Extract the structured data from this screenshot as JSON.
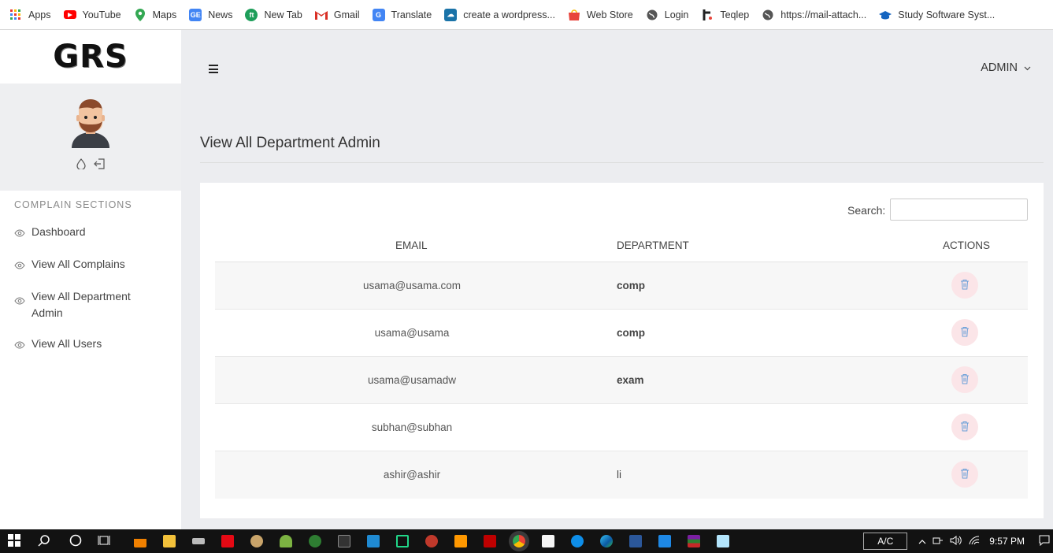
{
  "bookmarks": [
    {
      "label": "Apps",
      "icon": "apps-grid-icon",
      "color": "#e53935"
    },
    {
      "label": "YouTube",
      "icon": "youtube-icon",
      "color": "#ff0000"
    },
    {
      "label": "Maps",
      "icon": "maps-pin-icon",
      "color": "#34a853"
    },
    {
      "label": "News",
      "icon": "news-icon",
      "color": "#4285f4"
    },
    {
      "label": "New Tab",
      "icon": "new-tab-icon",
      "color": "#1e9e5a"
    },
    {
      "label": "Gmail",
      "icon": "gmail-icon",
      "color": "#d93025"
    },
    {
      "label": "Translate",
      "icon": "translate-icon",
      "color": "#4285f4"
    },
    {
      "label": "create a wordpress...",
      "icon": "wordpress-cloud-icon",
      "color": "#1a73a8"
    },
    {
      "label": "Web Store",
      "icon": "web-store-icon",
      "color": "#e8453c"
    },
    {
      "label": "Login",
      "icon": "globe-icon",
      "color": "#555555"
    },
    {
      "label": "Teqlep",
      "icon": "teqlep-icon",
      "color": "#222222"
    },
    {
      "label": "https://mail-attach...",
      "icon": "globe-icon",
      "color": "#555555"
    },
    {
      "label": "Study Software Syst...",
      "icon": "graduation-cap-icon",
      "color": "#1565c0"
    }
  ],
  "brand": "GRS",
  "sidebar": {
    "section_title": "COMPLAIN SECTIONS",
    "items": [
      {
        "label": "Dashboard"
      },
      {
        "label": "View All Complains"
      },
      {
        "label": "View All Department Admin"
      },
      {
        "label": "View All Users"
      }
    ]
  },
  "header": {
    "user_menu": "ADMIN"
  },
  "page": {
    "title": "View All Department Admin"
  },
  "table": {
    "search_label": "Search:",
    "search_value": "",
    "columns": [
      "EMAIL",
      "DEPARTMENT",
      "ACTIONS"
    ],
    "rows": [
      {
        "email": "usama@usama.com",
        "department": "comp"
      },
      {
        "email": "usama@usama",
        "department": "comp"
      },
      {
        "email": "usama@usamadw",
        "department": "exam"
      },
      {
        "email": "subhan@subhan",
        "department": ""
      },
      {
        "email": "ashir@ashir",
        "department": "li"
      }
    ]
  },
  "taskbar": {
    "ac_label": "A/C",
    "time": "9:57 PM"
  },
  "colors": {
    "delete_bg": "#fbe5e8",
    "delete_icon": "#6a9fd8",
    "accent": "#ecedf0"
  }
}
